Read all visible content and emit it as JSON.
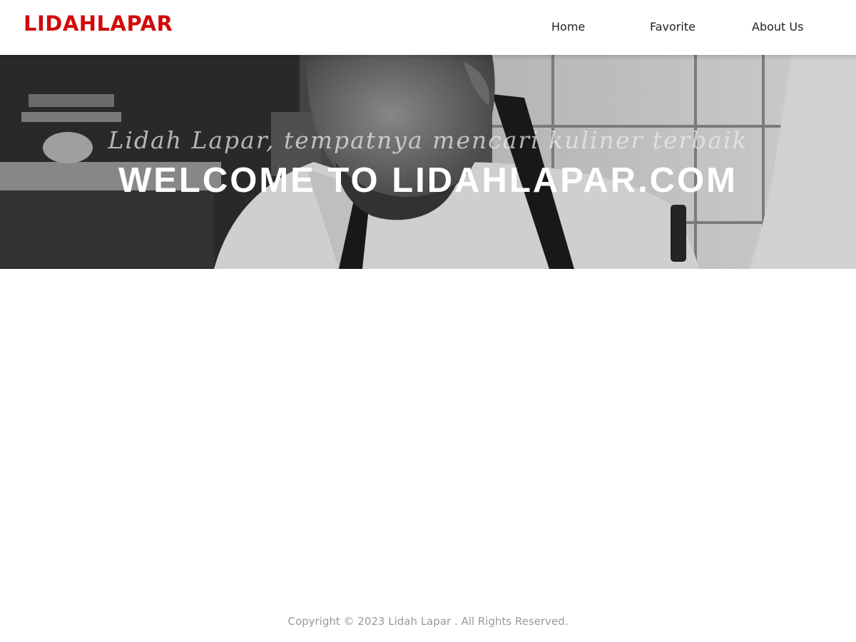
{
  "brand": {
    "name": "LIDAHLAPAR",
    "color": "#d10a0a"
  },
  "nav": {
    "items": [
      {
        "label": "Home"
      },
      {
        "label": "Favorite"
      },
      {
        "label": "About Us"
      }
    ]
  },
  "hero": {
    "tagline": "Lidah Lapar, tempatnya mencari kuliner terbaik",
    "title": "WELCOME TO LIDAHLAPAR.COM"
  },
  "footer": {
    "copyright": "Copyright © 2023 Lidah Lapar . All Rights Reserved."
  }
}
